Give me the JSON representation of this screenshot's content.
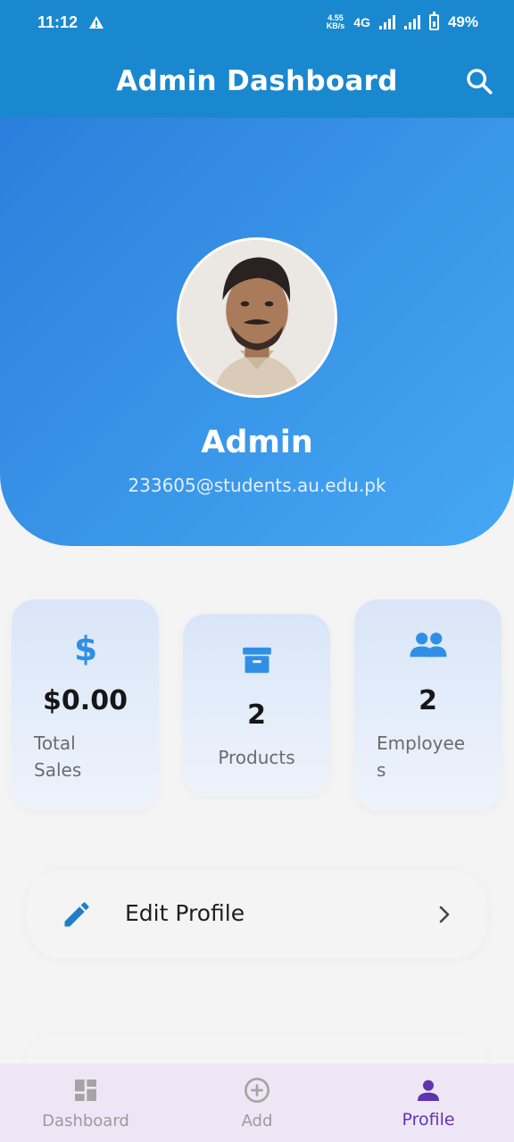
{
  "status_bar": {
    "time": "11:12",
    "speed_value": "4.55",
    "speed_unit": "KB/s",
    "network": "4G",
    "battery": "49%"
  },
  "app_bar": {
    "title": "Admin Dashboard",
    "search_icon": "search-icon"
  },
  "profile": {
    "name": "Admin",
    "email": "233605@students.au.edu.pk"
  },
  "stats": [
    {
      "icon": "dollar-icon",
      "value": "$0.00",
      "label_line1": "Total",
      "label_line2": "Sales"
    },
    {
      "icon": "archive-box-icon",
      "value": "2",
      "label_line1": "Products",
      "label_line2": ""
    },
    {
      "icon": "people-icon",
      "value": "2",
      "label_line1": "Employee",
      "label_line2": "s"
    }
  ],
  "actions": {
    "edit_profile": "Edit Profile"
  },
  "bottom_nav": [
    {
      "label": "Dashboard",
      "icon": "dashboard-icon",
      "active": false
    },
    {
      "label": "Add",
      "icon": "add-circle-icon",
      "active": false
    },
    {
      "label": "Profile",
      "icon": "person-icon",
      "active": true
    }
  ],
  "colors": {
    "app_bar": "#1a88cf",
    "header_gradient_start": "#2b7fdc",
    "header_gradient_end": "#45a7f4",
    "stat_icon": "#2f8fe6",
    "nav_active": "#5e35b1",
    "nav_background": "#efe6f5"
  }
}
